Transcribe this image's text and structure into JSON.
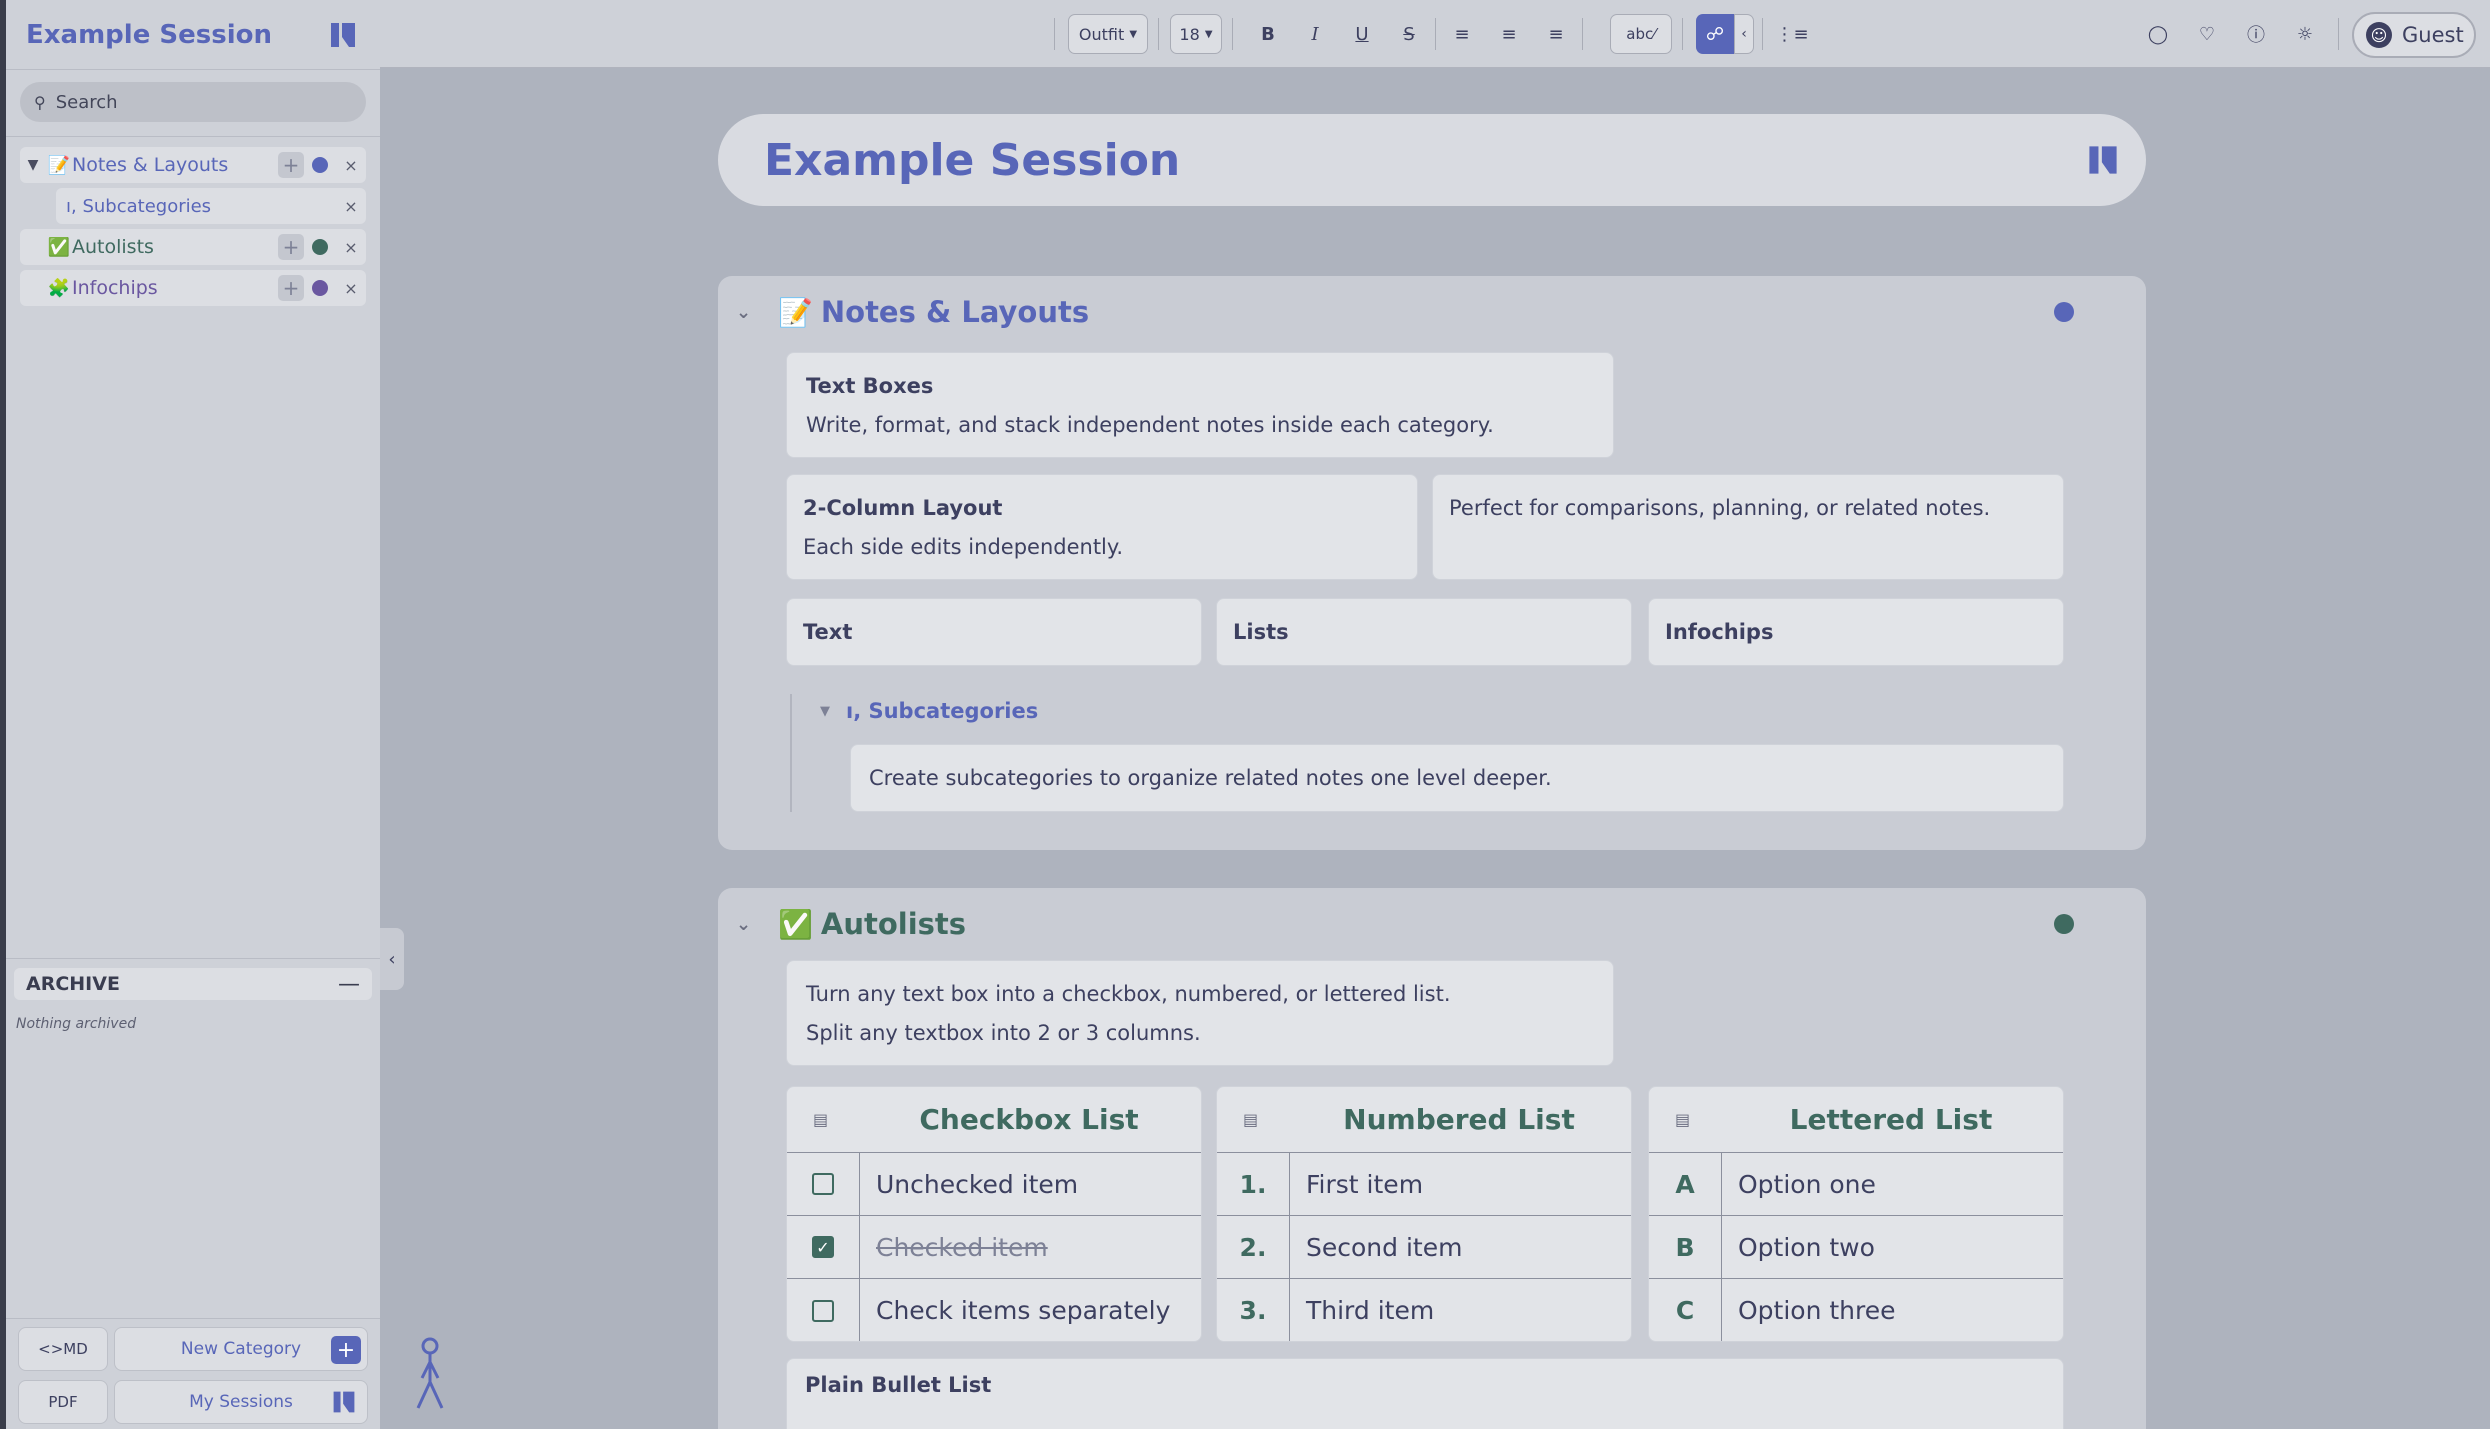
{
  "app": {
    "title": "Example Session",
    "search_placeholder": "Search"
  },
  "sidebar": {
    "items": [
      {
        "label": "Notes & Layouts",
        "emoji": "📝",
        "dot_color": "#5866b8"
      },
      {
        "label": "ı, Subcategories"
      },
      {
        "label": "Autolists",
        "emoji": "✅",
        "dot_color": "#3f6a60"
      },
      {
        "label": "Infochips",
        "emoji": "🧩",
        "dot_color": "#6a57a0"
      }
    ],
    "archive_label": "ARCHIVE",
    "archive_empty": "Nothing archived",
    "md_label": "<>MD",
    "pdf_label": "PDF",
    "new_category_label": "New Category",
    "my_sessions_label": "My Sessions"
  },
  "toolbar": {
    "font": "Outfit",
    "size": "18",
    "bold": "B",
    "italic": "I",
    "underline": "U",
    "strike": "S",
    "spell": "abc⁄",
    "guest": "Guest"
  },
  "main": {
    "title": "Example Session",
    "notes": {
      "title": "Notes & Layouts",
      "emoji": "📝",
      "text_boxes_title": "Text Boxes",
      "text_boxes_body": "Write, format, and stack independent notes inside each category.",
      "two_col_title": "2-Column Layout",
      "two_col_body": "Each side edits independently.",
      "two_col_right": "Perfect for comparisons, planning, or related notes.",
      "col_text": "Text",
      "col_lists": "Lists",
      "col_infochips": "Infochips",
      "sub_title": "ı, Subcategories",
      "sub_body": "Create subcategories to organize related notes one level deeper."
    },
    "autolists": {
      "title": "Autolists",
      "emoji": "✅",
      "intro_1": "Turn any text box into a checkbox, numbered, or lettered list.",
      "intro_2": "Split any textbox into 2 or 3 columns.",
      "checkbox": {
        "title": "Checkbox List",
        "items": [
          "Unchecked item",
          "Checked item",
          "Check items separately"
        ]
      },
      "numbered": {
        "title": "Numbered List",
        "markers": [
          "1.",
          "2.",
          "3."
        ],
        "items": [
          "First item",
          "Second item",
          "Third item"
        ]
      },
      "lettered": {
        "title": "Lettered List",
        "markers": [
          "A",
          "B",
          "C"
        ],
        "items": [
          "Option one",
          "Option two",
          "Option three"
        ]
      },
      "bullet_title": "Plain Bullet List"
    }
  },
  "colors": {
    "accent": "#5866b8",
    "green": "#3f6a60",
    "purple": "#6a57a0"
  }
}
